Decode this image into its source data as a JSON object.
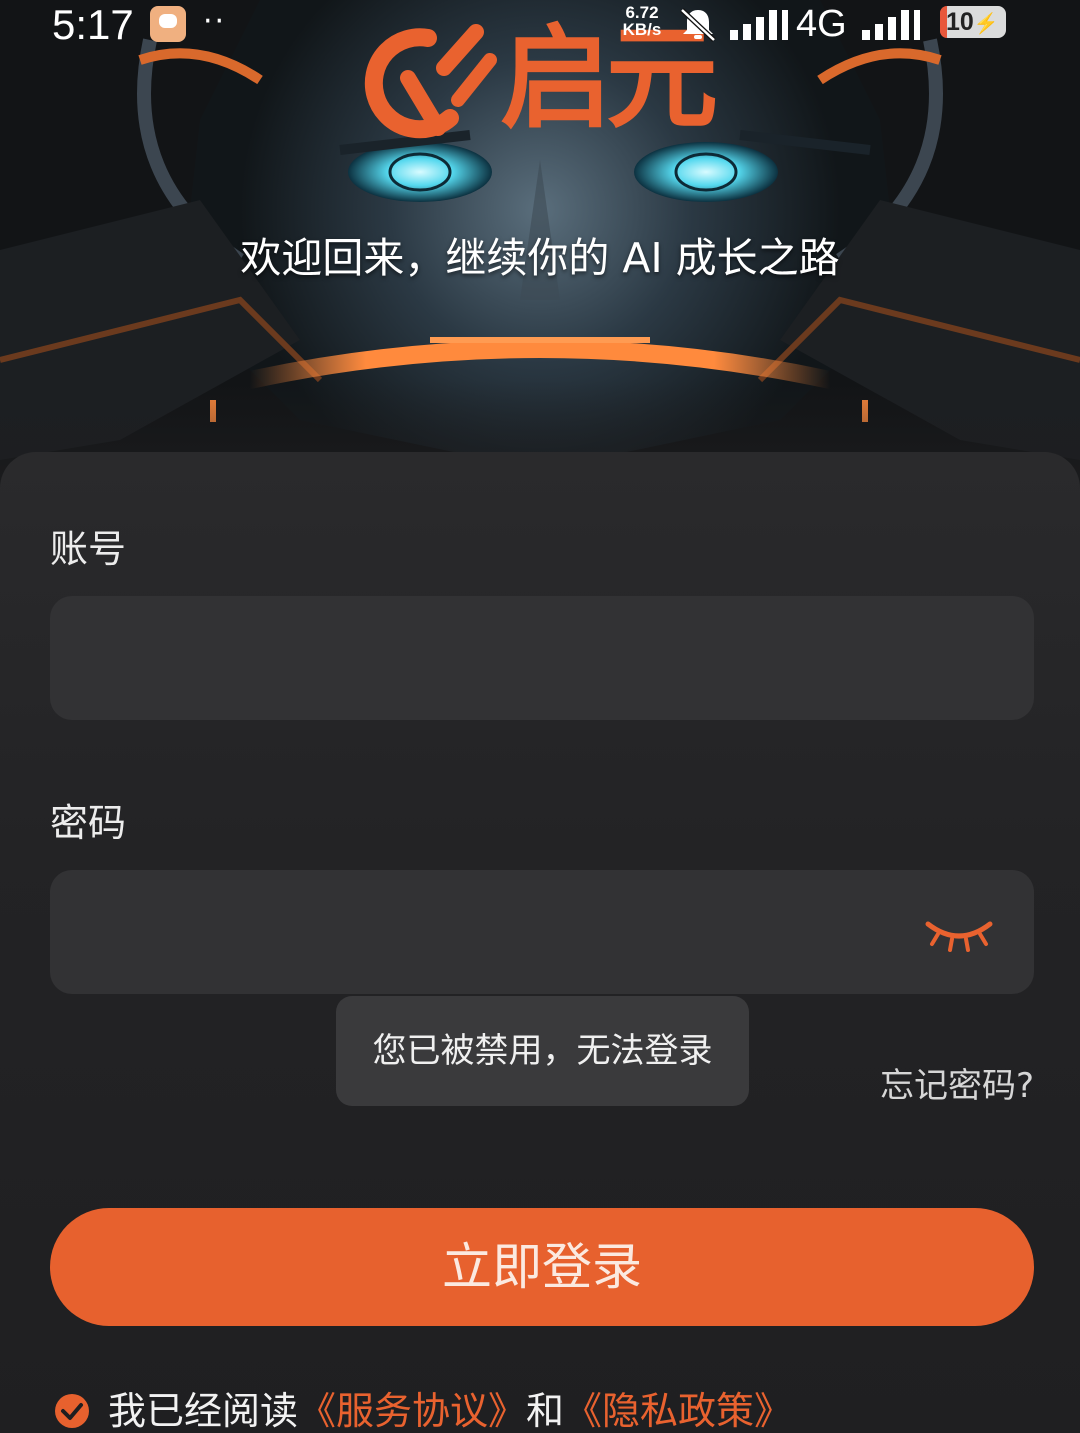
{
  "status_bar": {
    "time": "5:17",
    "dots": "··",
    "speed_value": "6.72",
    "speed_unit": "KB/s",
    "network": "4G",
    "battery": "10",
    "battery_level": 0.1
  },
  "header": {
    "brand": "启元",
    "welcome": "欢迎回来，继续你的 AI 成长之路"
  },
  "form": {
    "account_label": "账号",
    "account_value": "",
    "password_label": "密码",
    "password_value": "",
    "forgot_password": "忘记密码?",
    "login_button": "立即登录"
  },
  "toast": {
    "message": "您已被禁用，无法登录"
  },
  "agreement": {
    "prefix": "我已经阅读",
    "service_link": "《服务协议》",
    "conjunction": "和",
    "privacy_link": "《隐私政策》",
    "checked": true
  },
  "colors": {
    "accent": "#e7612e",
    "background": "#1e1e20",
    "input": "#323234",
    "toast": "#3a3a3c"
  },
  "icons": {
    "app": "app-notification-icon",
    "bell": "bell-muted-icon",
    "signal": "signal-bars-icon",
    "battery": "battery-charging-icon",
    "eye": "eye-closed-icon",
    "check": "check-circle-icon",
    "logo": "qiyuan-logo-icon"
  }
}
